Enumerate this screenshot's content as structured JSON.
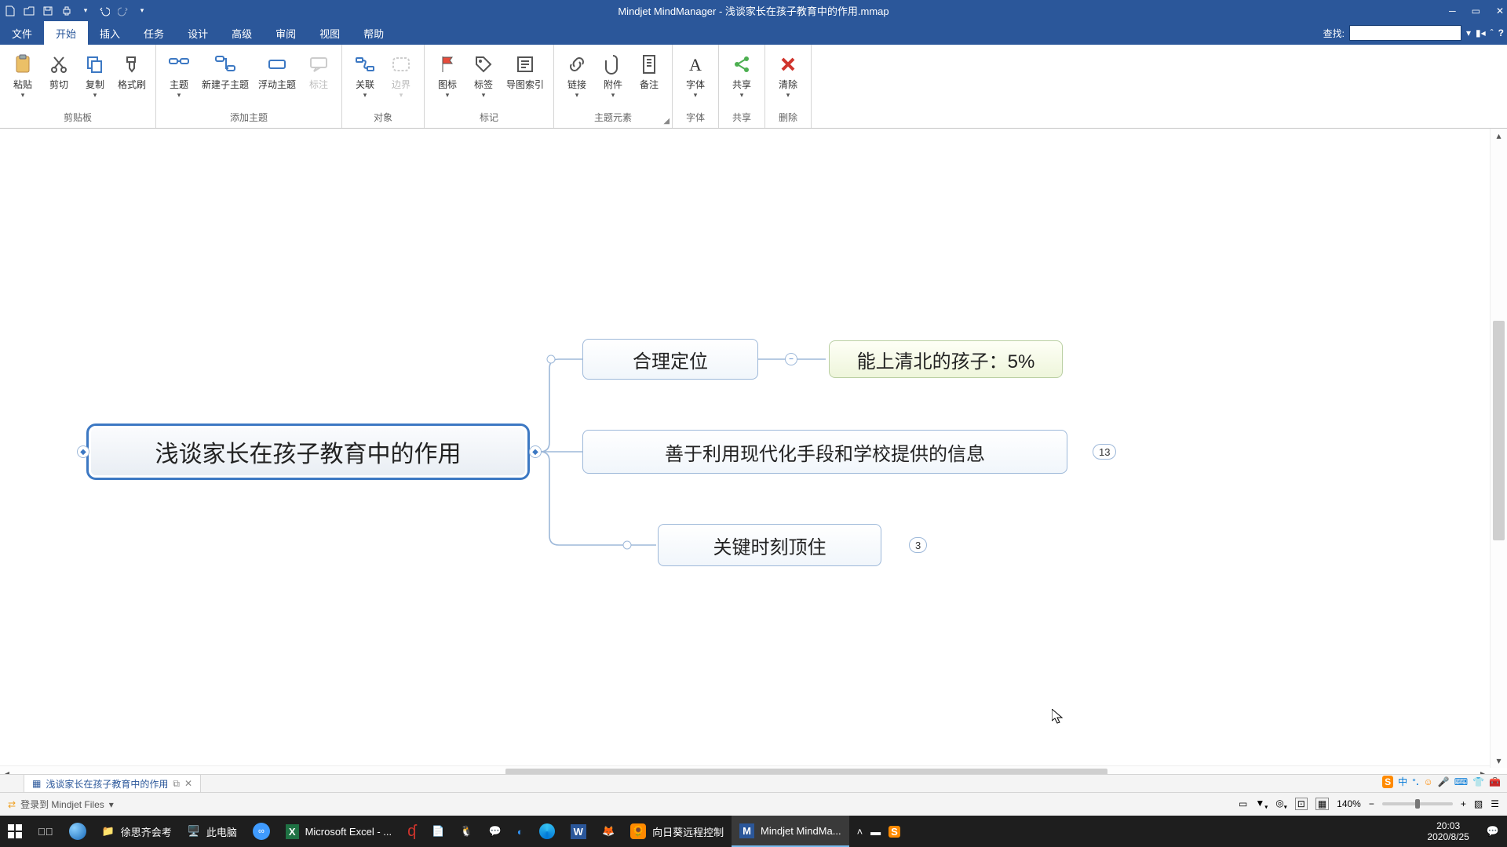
{
  "app": {
    "title": "Mindjet MindManager - 浅谈家长在孩子教育中的作用.mmap"
  },
  "menu": {
    "file": "文件",
    "home": "开始",
    "insert": "插入",
    "task": "任务",
    "design": "设计",
    "advanced": "高级",
    "review": "审阅",
    "view": "视图",
    "help": "帮助",
    "search_label": "查找:"
  },
  "ribbon": {
    "clipboard": {
      "label": "剪贴板",
      "paste": "粘贴",
      "cut": "剪切",
      "copy": "复制",
      "formatpainter": "格式刷"
    },
    "topics": {
      "label": "添加主题",
      "topic": "主题",
      "subtopic": "新建子主题",
      "floating": "浮动主题",
      "callout": "标注"
    },
    "object": {
      "label": "对象",
      "relation": "关联",
      "boundary": "边界"
    },
    "marker": {
      "label": "标记",
      "icon": "图标",
      "tag": "标签",
      "index": "导图索引"
    },
    "element": {
      "label": "主题元素",
      "link": "链接",
      "attach": "附件",
      "note": "备注"
    },
    "font": {
      "label": "字体",
      "font": "字体"
    },
    "share": {
      "label": "共享",
      "share": "共享"
    },
    "delete": {
      "label": "删除",
      "clear": "清除"
    }
  },
  "map": {
    "center": "浅谈家长在孩子教育中的作用",
    "n1": "合理定位",
    "n1a": "能上清北的孩子：5%",
    "n2": "善于利用现代化手段和学校提供的信息",
    "n2_count": "13",
    "n3": "关键时刻顶住",
    "n3_count": "3"
  },
  "doc_tab": {
    "name": "浅谈家长在孩子教育中的作用"
  },
  "status": {
    "login": "登录到 Mindjet Files",
    "zoom": "140%"
  },
  "ime": {
    "zhong": "中"
  },
  "taskbar": {
    "folder": "徐思齐会考",
    "thispc": "此电脑",
    "excel": "Microsoft Excel - ...",
    "sunflower": "向日葵远程控制",
    "mindjet": "Mindjet MindMa...",
    "time": "20:03",
    "date": "2020/8/25"
  }
}
